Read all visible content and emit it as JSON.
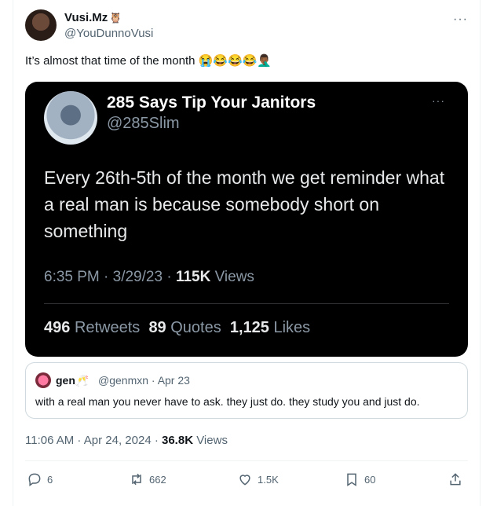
{
  "tweet": {
    "display_name": "Vusi.Mz",
    "name_emoji": "🦉",
    "handle": "@YouDunnoVusi",
    "more": "···",
    "text": "It’s almost that time of the month",
    "emojis": "😭😂😂😂🤦🏾‍♂️"
  },
  "image_tweet": {
    "display_name": "285 Says Tip Your Janitors",
    "handle": "@285Slim",
    "more": "···",
    "body": "Every 26th-5th of the month we get reminder what a real man is because somebody short on something",
    "time_date": "6:35 PM · 3/29/23 ·",
    "views_count": "115K",
    "views_label": "Views",
    "retweets_count": "496",
    "retweets_label": "Retweets",
    "quotes_count": "89",
    "quotes_label": "Quotes",
    "likes_count": "1,125",
    "likes_label": "Likes"
  },
  "quote": {
    "name": "gen",
    "name_emoji": "🥂",
    "handle_date": "@genmxn · Apr 23",
    "text": "with a real man you never have to ask. they just do. they study you and just do."
  },
  "meta": {
    "time_date": "11:06 AM · Apr 24, 2024 ·",
    "views_count": "36.8K",
    "views_label": "Views"
  },
  "actions": {
    "replies": "6",
    "reposts": "662",
    "likes": "1.5K",
    "bookmarks": "60"
  }
}
